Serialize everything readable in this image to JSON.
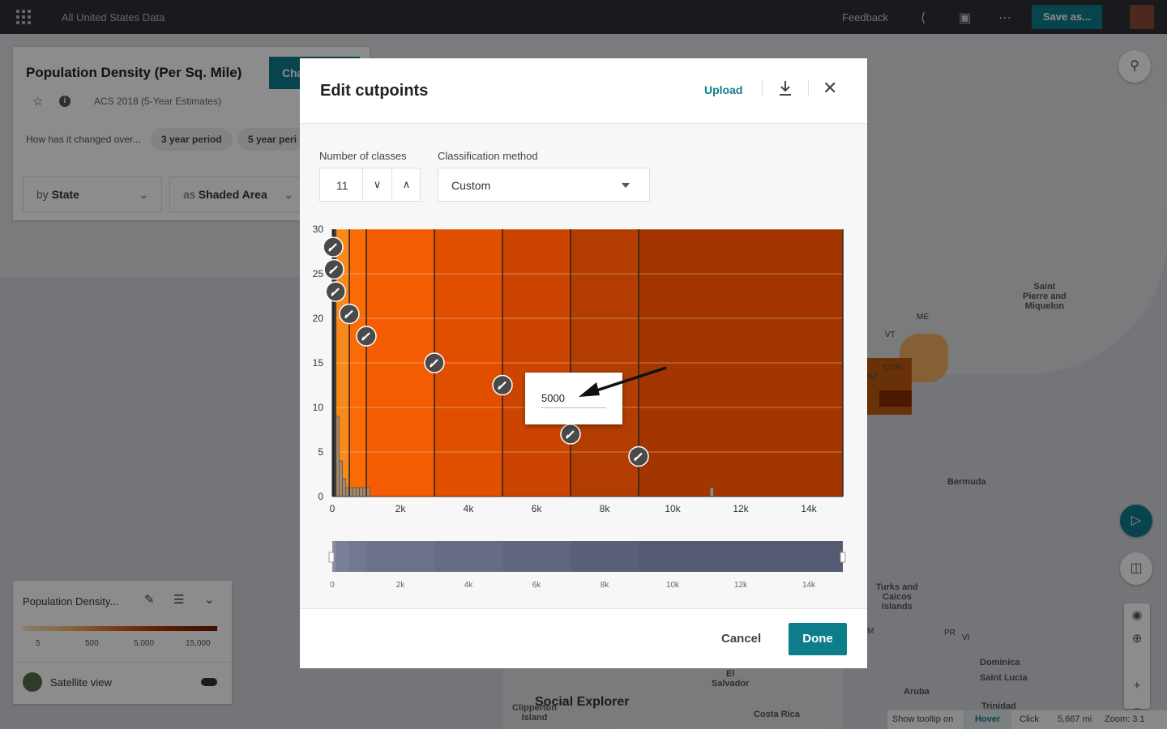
{
  "app": {
    "title": "All United States Data",
    "feedback": "Feedback",
    "save_as": "Save as..."
  },
  "info_panel": {
    "title": "Population Density (Per Sq. Mile)",
    "change_button": "Cha",
    "source": "ACS 2018 (5-Year Estimates)",
    "question": "How has it changed over...",
    "pills": [
      "3 year period",
      "5 year peri"
    ],
    "by_prefix": "by",
    "by_value": "State",
    "as_prefix": "as",
    "as_value": "Shaded Area"
  },
  "legend": {
    "title": "Population Density...",
    "ticks": [
      "5",
      "500",
      "5,000",
      "15,000"
    ],
    "satellite": "Satellite view"
  },
  "map_labels": {
    "saint_pierre": "Saint\nPierre and\nMiquelon",
    "bermuda": "Bermuda",
    "turks": "Turks and\nCaicos\nIslands",
    "dominica": "Dominica",
    "saint_lucia": "Saint Lucia",
    "aruba": "Aruba",
    "el_salvador": "El\nSalvador",
    "costa_rica": "Costa Rica",
    "clipperton": "Clipperton\nIsland",
    "trinidad": "Trinidad",
    "me": "ME",
    "vt": "VT",
    "ct": "CT",
    "ri": "RI",
    "nj": "NJ",
    "pr": "PR",
    "vi": "VI",
    "m": "M"
  },
  "logo": "Social Explorer",
  "status": {
    "tooltip": "Show tooltip on",
    "hover": "Hover",
    "click": "Click",
    "scale": "5,667 mi",
    "zoom": "Zoom: 3.1"
  },
  "modal": {
    "title": "Edit cutpoints",
    "upload": "Upload",
    "num_classes_label": "Number of classes",
    "num_classes_value": "11",
    "method_label": "Classification method",
    "method_value": "Custom",
    "popup_value": "5000",
    "cancel": "Cancel",
    "done": "Done"
  },
  "chart_data": {
    "type": "bar",
    "title": "",
    "x_tick_labels": [
      "0",
      "2k",
      "4k",
      "6k",
      "8k",
      "10k",
      "12k",
      "14k"
    ],
    "x_ticks": [
      0,
      2000,
      4000,
      6000,
      8000,
      10000,
      12000,
      14000
    ],
    "y_tick_labels": [
      "0",
      "5",
      "10",
      "15",
      "20",
      "25",
      "30"
    ],
    "y_ticks": [
      0,
      5,
      10,
      15,
      20,
      25,
      30
    ],
    "xlim": [
      0,
      15000
    ],
    "ylim": [
      0,
      30
    ],
    "cutpoints": [
      5,
      25,
      50,
      100,
      500,
      1000,
      3000,
      5000,
      7000,
      9000,
      15000
    ],
    "handle_levels": [
      28,
      25.5,
      23,
      20.5,
      18,
      15,
      12.5,
      7,
      4.5
    ],
    "class_colors": [
      "#f7c27a",
      "#f6b25c",
      "#f5a33f",
      "#f59420",
      "#f8891a",
      "#fa6a05",
      "#f45c04",
      "#e04f00",
      "#cc4500",
      "#b33d00",
      "#a33600"
    ],
    "histogram": {
      "bin_width": 100,
      "bins": [
        {
          "x": 0,
          "count": 29
        },
        {
          "x": 100,
          "count": 9
        },
        {
          "x": 200,
          "count": 4
        },
        {
          "x": 300,
          "count": 2
        },
        {
          "x": 400,
          "count": 1
        },
        {
          "x": 500,
          "count": 1
        },
        {
          "x": 600,
          "count": 1
        },
        {
          "x": 700,
          "count": 1
        },
        {
          "x": 800,
          "count": 1
        },
        {
          "x": 900,
          "count": 1
        },
        {
          "x": 1000,
          "count": 1
        },
        {
          "x": 11100,
          "count": 1
        }
      ]
    }
  }
}
